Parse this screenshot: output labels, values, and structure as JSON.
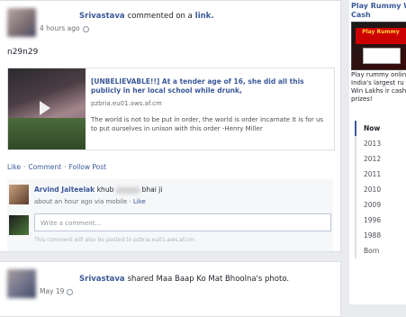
{
  "post1": {
    "author": "Srivastava",
    "action": "commented on a",
    "target": "link.",
    "time": "4 hours ago",
    "status": "n29n29",
    "shared_link": {
      "title": "[UNBELIEVABLE!!] At a tender age of 16, she did all this publicly in her local school while drunk,",
      "domain": "pzbria.eu01.aws.af.cm",
      "description": "The world is not to be put in order, the world is order incarnate It is for us to put ourselves in unison with this order -Henry Miller"
    },
    "actions": [
      "Like",
      "Comment",
      "Follow Post"
    ],
    "comment": {
      "author": "Arvind Jaiteelak",
      "text": "khub",
      "text2": "bhai ji",
      "meta": "about an hour ago via mobile",
      "like": "Like"
    },
    "write_placeholder": "Write a comment...",
    "write_note": "This comment will also be posted to pzbria.eu01.aws.af.cm."
  },
  "post2": {
    "author": "Srivastava",
    "action": "shared",
    "target": "Maa Baap Ko Mat Bhoolna's photo.",
    "time": "May 19"
  },
  "sidebar": {
    "ad_title": "Play Rummy W Cash",
    "ad_logo": "Play Rummy",
    "ad_body": "Play rummy onlin India's largest ru site. Win Lakhs ir cash prizes!",
    "years": [
      "Now",
      "2013",
      "2012",
      "2011",
      "2010",
      "2009",
      "1996",
      "1988",
      "Born"
    ]
  }
}
